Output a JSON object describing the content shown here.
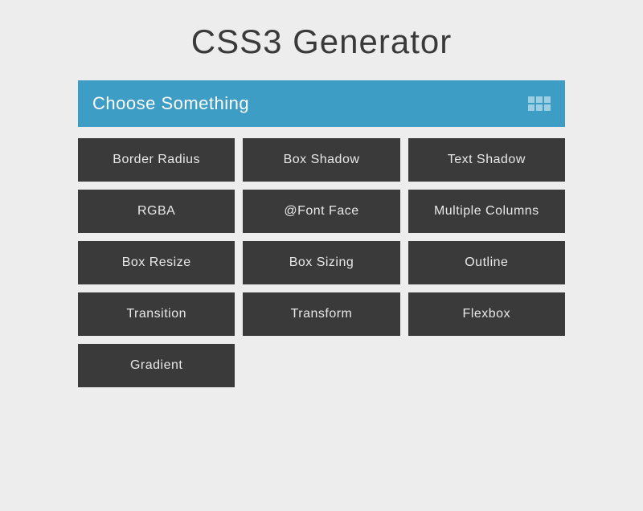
{
  "title": "CSS3 Generator",
  "header": {
    "label": "Choose Something"
  },
  "tiles": [
    "Border Radius",
    "Box Shadow",
    "Text Shadow",
    "RGBA",
    "@Font Face",
    "Multiple Columns",
    "Box Resize",
    "Box Sizing",
    "Outline",
    "Transition",
    "Transform",
    "Flexbox",
    "Gradient"
  ]
}
